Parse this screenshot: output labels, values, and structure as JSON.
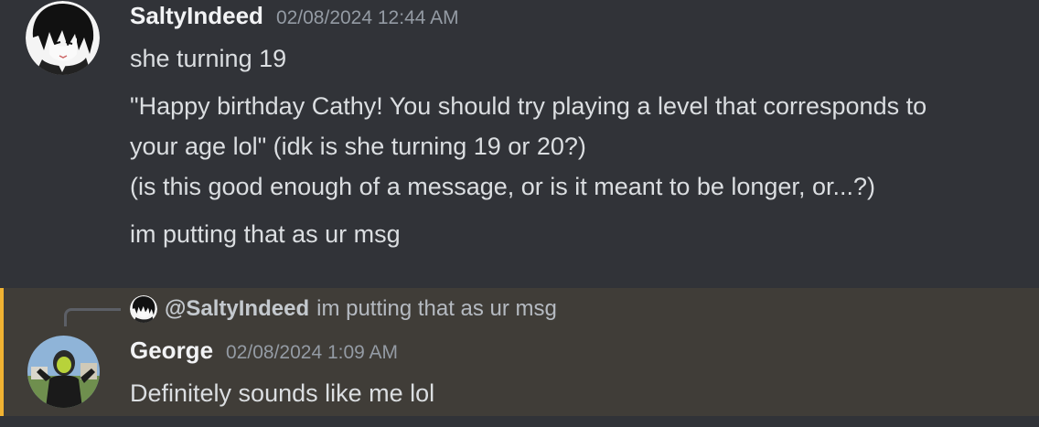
{
  "messages": [
    {
      "author": "SaltyIndeed",
      "timestamp": "02/08/2024 12:44 AM",
      "avatar_icon": "anime-avatar-icon",
      "lines": [
        "she turning 19",
        "\"Happy birthday Cathy! You should try playing a level that corresponds to",
        "your age lol\"  (idk is she turning 19 or 20?)",
        "(is this good enough of a message, or is it meant to be longer, or...?)",
        "im putting that as ur msg"
      ]
    },
    {
      "author": "George",
      "timestamp": "02/08/2024 1:09 AM",
      "avatar_icon": "photo-avatar-icon",
      "reply": {
        "mention": "@SaltyIndeed",
        "text": "im putting that as ur msg"
      },
      "lines": [
        "Definitely sounds like me lol"
      ]
    }
  ],
  "colors": {
    "background": "#313338",
    "highlight_background": "#403d38",
    "highlight_bar": "#f0b232",
    "username": "#f2f3f5",
    "timestamp": "#949ba4",
    "text": "#dbdee1"
  }
}
